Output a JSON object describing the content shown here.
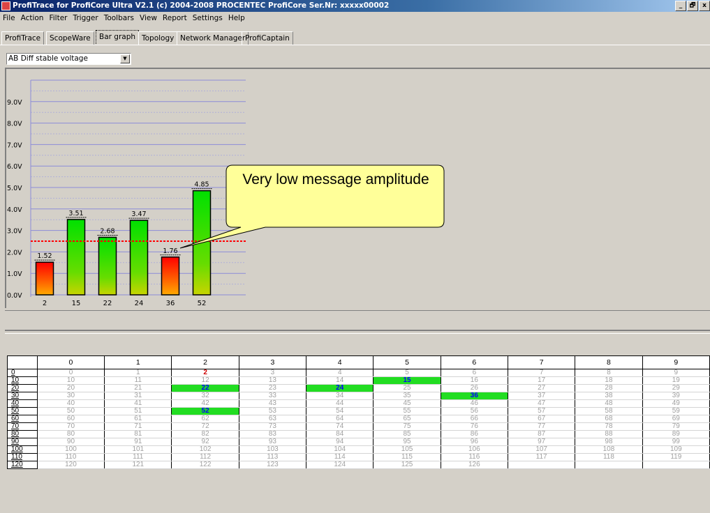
{
  "window": {
    "title": "ProfiTrace for ProfiCore Ultra V2.1 (c) 2004-2008 PROCENTEC  ProfiCore Ser.Nr: xxxxx00002",
    "minimize": "_",
    "restore": "🗗",
    "close": "x"
  },
  "menu": [
    "File",
    "Action",
    "Filter",
    "Trigger",
    "Toolbars",
    "View",
    "Report",
    "Settings",
    "Help"
  ],
  "tabs": [
    "ProfiTrace",
    "ScopeWare",
    "Bar graph",
    "Topology",
    "Network Manager",
    "ProfiCaptain"
  ],
  "active_tab": "Bar graph",
  "measurement_select": {
    "value": "AB Diff stable voltage",
    "arrow": "▼"
  },
  "chart_data": {
    "type": "bar",
    "categories": [
      "2",
      "15",
      "22",
      "24",
      "36",
      "52"
    ],
    "values": [
      1.52,
      3.51,
      2.68,
      3.47,
      1.76,
      4.85
    ],
    "data_labels": [
      "1.52",
      "3.51",
      "2.68",
      "3.47",
      "1.76",
      "4.85"
    ],
    "y_ticks": [
      "0.0V",
      "1.0V",
      "2.0V",
      "3.0V",
      "4.0V",
      "5.0V",
      "6.0V",
      "7.0V",
      "8.0V",
      "9.0V"
    ],
    "ylim": [
      0,
      10
    ],
    "threshold": 2.5,
    "threshold_color": "#ff0000",
    "low_value_color": "#ff0000",
    "ok_value_color": "#00e000",
    "grid": true
  },
  "callout": {
    "text": "Very low message amplitude",
    "fill": "#ffff99"
  },
  "station_grid": {
    "col_headers": [
      "",
      "0",
      "1",
      "2",
      "3",
      "4",
      "5",
      "6",
      "7",
      "8",
      "9"
    ],
    "rows": [
      {
        "label": "0",
        "cells": [
          "0",
          "1",
          "2",
          "3",
          "4",
          "5",
          "6",
          "7",
          "8",
          "9"
        ]
      },
      {
        "label": "10",
        "cells": [
          "10",
          "11",
          "12",
          "13",
          "14",
          "15",
          "16",
          "17",
          "18",
          "19"
        ]
      },
      {
        "label": "20",
        "cells": [
          "20",
          "21",
          "22",
          "23",
          "24",
          "25",
          "26",
          "27",
          "28",
          "29"
        ]
      },
      {
        "label": "30",
        "cells": [
          "30",
          "31",
          "32",
          "33",
          "34",
          "35",
          "36",
          "37",
          "38",
          "39"
        ]
      },
      {
        "label": "40",
        "cells": [
          "40",
          "41",
          "42",
          "43",
          "44",
          "45",
          "46",
          "47",
          "48",
          "49"
        ]
      },
      {
        "label": "50",
        "cells": [
          "50",
          "51",
          "52",
          "53",
          "54",
          "55",
          "56",
          "57",
          "58",
          "59"
        ]
      },
      {
        "label": "60",
        "cells": [
          "60",
          "61",
          "62",
          "63",
          "64",
          "65",
          "66",
          "67",
          "68",
          "69"
        ]
      },
      {
        "label": "70",
        "cells": [
          "70",
          "71",
          "72",
          "73",
          "74",
          "75",
          "76",
          "77",
          "78",
          "79"
        ]
      },
      {
        "label": "80",
        "cells": [
          "80",
          "81",
          "82",
          "83",
          "84",
          "85",
          "86",
          "87",
          "88",
          "89"
        ]
      },
      {
        "label": "90",
        "cells": [
          "90",
          "91",
          "92",
          "93",
          "94",
          "95",
          "96",
          "97",
          "98",
          "99"
        ]
      },
      {
        "label": "100",
        "cells": [
          "100",
          "101",
          "102",
          "103",
          "104",
          "105",
          "106",
          "107",
          "108",
          "109"
        ]
      },
      {
        "label": "110",
        "cells": [
          "110",
          "111",
          "112",
          "113",
          "114",
          "115",
          "116",
          "117",
          "118",
          "119"
        ]
      },
      {
        "label": "120",
        "cells": [
          "120",
          "121",
          "122",
          "123",
          "124",
          "125",
          "126",
          "",
          "",
          ""
        ]
      }
    ],
    "active_stations": [
      "15",
      "22",
      "24",
      "36",
      "52"
    ],
    "master_stations": [
      "2"
    ],
    "active_color": "#22dd22"
  }
}
